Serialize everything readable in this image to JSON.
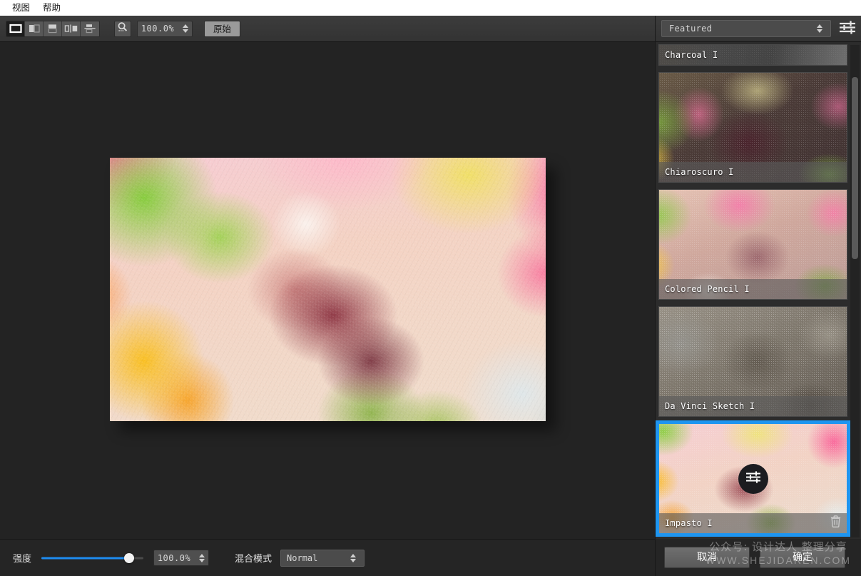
{
  "menubar": {
    "items": [
      {
        "label": "视图",
        "name": "menu-view"
      },
      {
        "label": "帮助",
        "name": "menu-help"
      }
    ]
  },
  "toolbar": {
    "view_modes": [
      {
        "name": "view-mode-single",
        "icon": "single-view-icon",
        "active": true
      },
      {
        "name": "view-mode-split-vertical",
        "icon": "split-vertical-icon",
        "active": false
      },
      {
        "name": "view-mode-split-horizontal",
        "icon": "split-horizontal-icon",
        "active": false
      },
      {
        "name": "view-mode-side-by-side",
        "icon": "side-by-side-icon",
        "active": false
      },
      {
        "name": "view-mode-stacked",
        "icon": "stacked-view-icon",
        "active": false
      }
    ],
    "zoom_icon": "magnifier-icon",
    "zoom_value": "100.0%",
    "original_button": "原始"
  },
  "right_panel": {
    "preset_category": "Featured",
    "settings_icon": "sliders-icon",
    "presets": [
      {
        "name": "Charcoal I",
        "clipped": true,
        "selected": false
      },
      {
        "name": "Chiaroscuro I",
        "clipped": false,
        "selected": false
      },
      {
        "name": "Colored Pencil I",
        "clipped": false,
        "selected": false
      },
      {
        "name": "Da Vinci Sketch I",
        "clipped": false,
        "selected": false
      },
      {
        "name": "Impasto I",
        "clipped": false,
        "selected": true
      }
    ],
    "selected_preset": "Impasto I",
    "selected_overlay_icon": "adjust-sliders-icon",
    "selected_delete_icon": "trash-icon",
    "footer": {
      "cancel_label": "取消",
      "ok_label": "确定"
    }
  },
  "bottom_bar": {
    "strength_label": "强度",
    "strength_value": "100.0%",
    "strength_percent": 86,
    "blend_label": "混合模式",
    "blend_value": "Normal"
  },
  "watermark": {
    "line1": "公众号: 设计达人  整理分享",
    "line2": "WWW.SHEJIDAREN.COM"
  },
  "colors": {
    "accent": "#1e8cf0",
    "selection_border": "#1e95f0",
    "canvas_bg": "#232323",
    "panel_bg": "#2c2c2c",
    "toolbar_bg": "#363636"
  }
}
